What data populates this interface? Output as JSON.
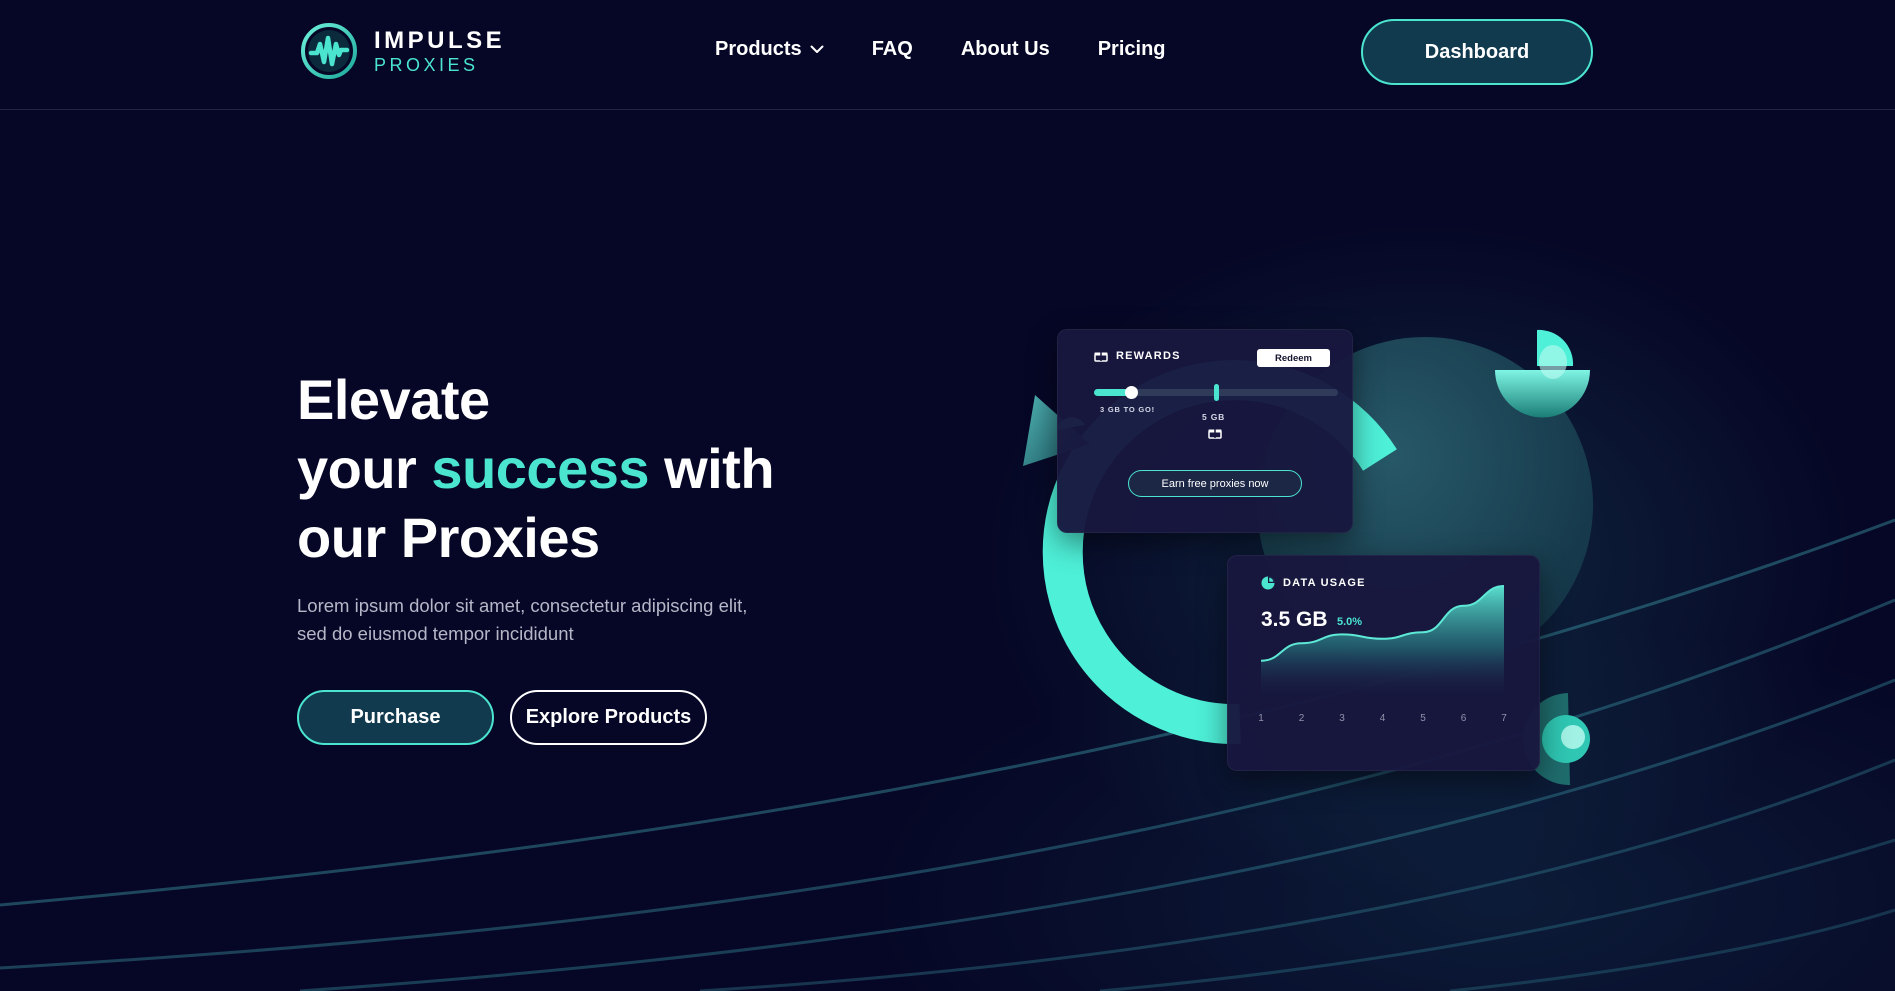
{
  "brand": {
    "name": "IMPULSE",
    "sub": "PROXIES",
    "accent": "#4ae4cf"
  },
  "nav": {
    "items": [
      "Products",
      "FAQ",
      "About Us",
      "Pricing"
    ],
    "dropdown_icon": "chevron-down-icon"
  },
  "header": {
    "dashboard_label": "Dashboard"
  },
  "hero": {
    "title_line1": "Elevate",
    "title_line2_start": "your",
    "title_accent": "success",
    "title_line2_end": "with",
    "title_line3": "our Proxies",
    "subtitle": "Lorem ipsum dolor sit amet, consectetur adipiscing elit, sed do eiusmod tempor incididunt",
    "purchase_label": "Purchase",
    "explore_label": "Explore Products"
  },
  "rewards": {
    "title": "REWARDS",
    "redeem_label": "Redeem",
    "progress_label": "3 GB TO GO!",
    "goal_label": "5 GB",
    "progress_fraction": 0.15,
    "goal_fraction": 0.5,
    "earn_label": "Earn free proxies now"
  },
  "usage": {
    "title": "DATA USAGE",
    "value": "3.5 GB",
    "change": "5.0%"
  },
  "chart_data": {
    "type": "area",
    "x": [
      "1",
      "2",
      "3",
      "4",
      "5",
      "6",
      "7"
    ],
    "values": [
      0.32,
      0.48,
      0.56,
      0.52,
      0.58,
      0.82,
      1.0
    ],
    "title": "",
    "xlabel": "",
    "ylabel": ""
  }
}
